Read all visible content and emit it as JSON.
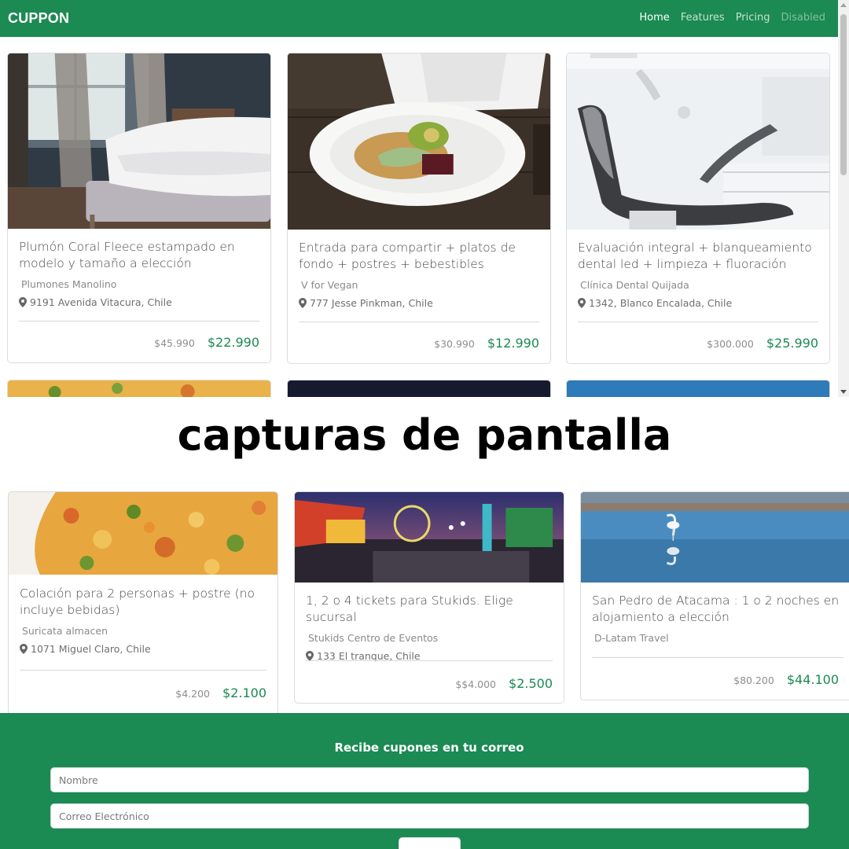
{
  "nav": {
    "brand": "CUPPON",
    "links": [
      {
        "label": "Home",
        "state": "active"
      },
      {
        "label": "Features",
        "state": "normal"
      },
      {
        "label": "Pricing",
        "state": "normal"
      },
      {
        "label": "Disabled",
        "state": "disabled"
      }
    ]
  },
  "cards_top": [
    {
      "title": "Plumón Coral Fleece estampado en modelo y tamaño a elección",
      "company": "Plumones Manolino",
      "location": "9191 Avenida Vitacura, Chile",
      "old_price": "$45.990",
      "new_price": "$22.990",
      "image": "bedroom-photo"
    },
    {
      "title": "Entrada para compartir + platos de fondo + postres + bebestibles",
      "company": "V for Vegan",
      "location": "777 Jesse Pinkman, Chile",
      "old_price": "$30.990",
      "new_price": "$12.990",
      "image": "salad-bowl-photo"
    },
    {
      "title": "Evaluación integral + blanqueamiento dental led + limpieza + fluoración",
      "company": "Clínica Dental Quijada",
      "location": "1342, Blanco Encalada, Chile",
      "old_price": "$300.000",
      "new_price": "$25.990",
      "image": "dental-chair-photo"
    }
  ],
  "caption": "capturas de pantalla",
  "cards_bottom": [
    {
      "title": "Colación para 2 personas + postre (no incluye bebidas)",
      "company": "Suricata almacen",
      "location": "1071 Miguel Claro, Chile",
      "old_price": "$4.200",
      "new_price": "$2.100",
      "image": "rice-dish-photo"
    },
    {
      "title": "1, 2 o 4 tickets para Stukids. Elige sucursal",
      "company": "Stukids Centro de Eventos",
      "location": "133 El tranque, Chile",
      "old_price": "$$4.000",
      "new_price": "$2.500",
      "image": "amusement-park-photo"
    },
    {
      "title": "San Pedro de Atacama : 1 o 2 noches en alojamiento a elección",
      "company": "D-Latam Travel",
      "location": "",
      "old_price": "$80.200",
      "new_price": "$44.100",
      "image": "flamingo-lagoon-photo"
    }
  ],
  "newsletter": {
    "heading": "Recibe cupones en tu correo",
    "name_placeholder": "Nombre",
    "email_placeholder": "Correo Electrónico"
  },
  "colors": {
    "brand_green": "#1b8a53"
  }
}
